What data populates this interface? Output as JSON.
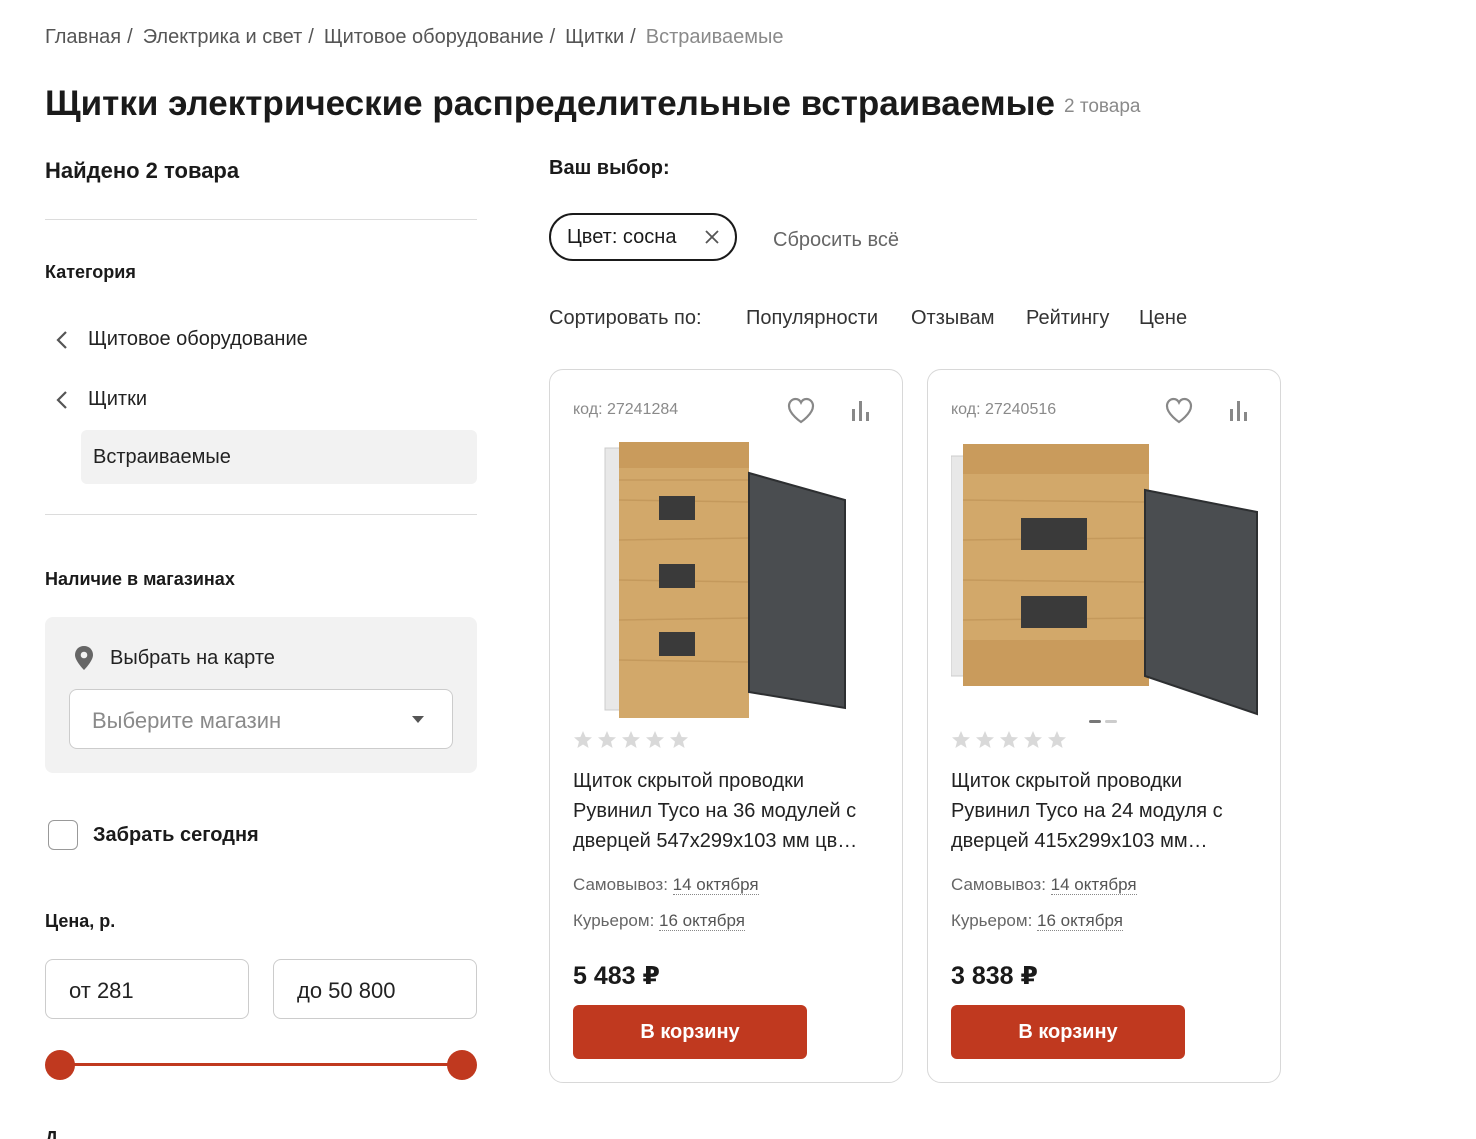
{
  "breadcrumb": [
    "Главная",
    "Электрика и свет",
    "Щитовое оборудование",
    "Щитки",
    "Встраиваемые"
  ],
  "page": {
    "title": "Щитки электрические распределительные встраиваемые",
    "count": "2 товара"
  },
  "sidebar": {
    "found": "Найдено 2 товара",
    "category_title": "Категория",
    "categories": {
      "parent1": "Щитовое оборудование",
      "parent2": "Щитки",
      "active": "Встраиваемые"
    },
    "availability_title": "Наличие в магазинах",
    "map_link": "Выбрать на карте",
    "store_placeholder": "Выберите магазин",
    "pickup_today": "Забрать сегодня",
    "price_title": "Цена, р.",
    "price_from": "от 281",
    "price_to": "до 50 800",
    "next_section": "Д"
  },
  "filters": {
    "choice_label": "Ваш выбор:",
    "chip": "Цвет: сосна",
    "reset": "Сбросить всё"
  },
  "sort": {
    "label": "Сортировать по:",
    "options": [
      "Популярности",
      "Отзывам",
      "Рейтингу",
      "Цене"
    ]
  },
  "products": [
    {
      "code": "код: 27241284",
      "name": "Щиток скрытой проводки Рувинил Tyco на 36 модулей с дверцей 547x299x103 мм цв…",
      "pickup_label": "Самовывоз:",
      "pickup_date": "14 октября",
      "courier_label": "Курьером:",
      "courier_date": "16 октября",
      "price": "5 483 ₽",
      "cart": "В корзину",
      "rating": 0
    },
    {
      "code": "код: 27240516",
      "name": "Щиток скрытой проводки Рувинил Tyco на 24 модуля с дверцей 415x299x103 мм…",
      "pickup_label": "Самовывоз:",
      "pickup_date": "14 октября",
      "courier_label": "Курьером:",
      "courier_date": "16 октября",
      "price": "3 838 ₽",
      "cart": "В корзину",
      "rating": 0
    }
  ],
  "colors": {
    "accent": "#c0391f",
    "wood": "#d2a86a",
    "door": "#4a4d50"
  }
}
